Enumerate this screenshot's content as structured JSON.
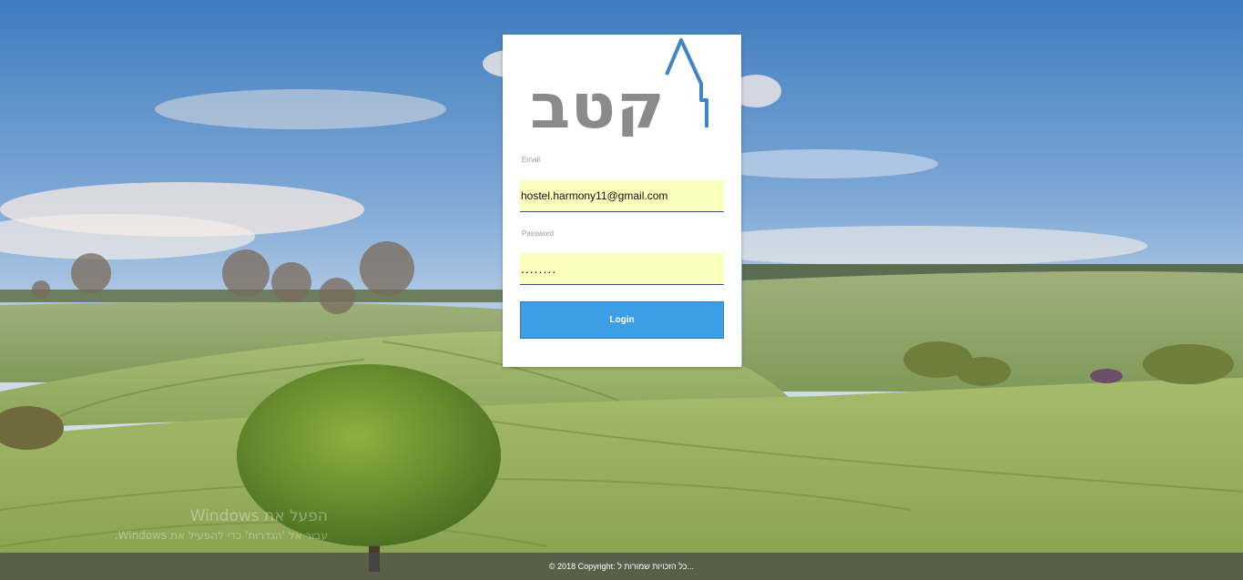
{
  "logo": {
    "text": "קטב",
    "icon": "house-outline-icon"
  },
  "form": {
    "email_label": "Email",
    "email_value": "hostel.harmony11@gmail.com",
    "password_label": "Password",
    "password_value": "........",
    "login_label": "Login"
  },
  "watermark": {
    "line1": "הפעל את Windows",
    "line2": "עבור אל 'הגדרות' כדי להפעיל את Windows."
  },
  "footer": {
    "copyright": "© 2018 Copyright: כל הזכויות שמורות ל..."
  },
  "colors": {
    "button": "#3c9fe6",
    "autofill": "#faffbd",
    "logo_text": "#8a8a8a",
    "logo_house": "#3e84c6"
  }
}
